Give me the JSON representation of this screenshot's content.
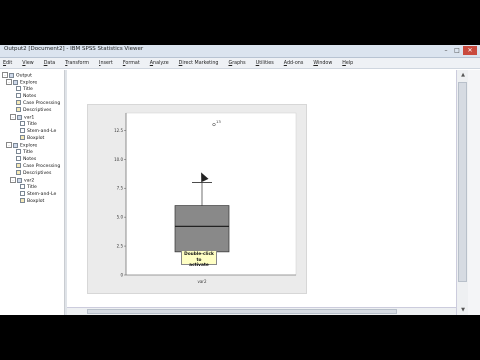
{
  "window": {
    "title": "Output2 [Document2] - IBM SPSS Statistics Viewer"
  },
  "menubar": {
    "items": [
      "Edit",
      "View",
      "Data",
      "Transform",
      "Insert",
      "Format",
      "Analyze",
      "Direct Marketing",
      "Graphs",
      "Utilities",
      "Add-ons",
      "Window",
      "Help"
    ]
  },
  "outline": {
    "root": "Output",
    "explore1": "Explore",
    "title1": "Title",
    "notes1": "Notes",
    "case1": "Case Processing",
    "desc1": "Descriptives",
    "var1": "var1",
    "var1_title": "Title",
    "var1_stem": "Stem-and-Le",
    "var1_box": "Boxplot",
    "explore2": "Explore",
    "title2": "Title",
    "notes2": "Notes",
    "case2": "Case Processing",
    "desc2": "Descriptives",
    "var2": "var2",
    "var2_title": "Title",
    "var2_stem": "Stem-and-Le",
    "var2_box": "Boxplot"
  },
  "tooltip": {
    "line1": "Double-click to",
    "line2": "activate"
  },
  "chart_data": {
    "type": "boxplot",
    "categories": [
      "var2"
    ],
    "ylim": [
      0,
      14
    ],
    "yticks": [
      "0",
      "2.5",
      "5.0",
      "7.5",
      "10.0",
      "12.5"
    ],
    "yticks_values": [
      0,
      2.5,
      5.0,
      7.5,
      10.0,
      12.5
    ],
    "box": {
      "min": 1,
      "q1": 2,
      "median": 4.2,
      "q3": 6,
      "max": 8
    },
    "outliers": [
      {
        "label": "13",
        "value": 13
      }
    ],
    "grid": false
  },
  "colors": {
    "box_fill": "#898989",
    "chart_bg": "#ebebeb",
    "tooltip_bg": "#ffffc4"
  }
}
